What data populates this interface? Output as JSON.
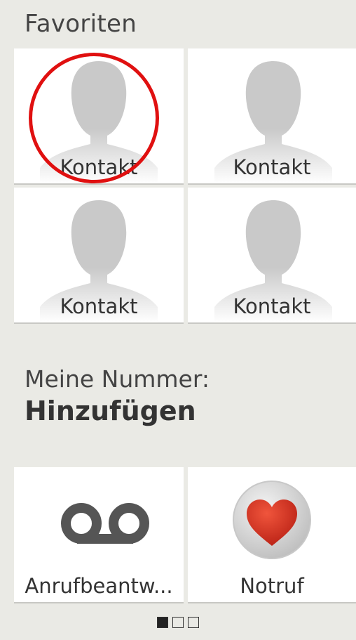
{
  "header": {
    "title": "Favoriten"
  },
  "favorites": [
    {
      "label": "Kontakt"
    },
    {
      "label": "Kontakt"
    },
    {
      "label": "Kontakt"
    },
    {
      "label": "Kontakt"
    }
  ],
  "my_number": {
    "label": "Meine Nummer:",
    "value": "Hinzufügen"
  },
  "shortcuts": [
    {
      "label": "Anrufbeantw...",
      "icon": "voicemail-icon"
    },
    {
      "label": "Notruf",
      "icon": "heart-icon"
    }
  ],
  "pager": {
    "pages": 3,
    "active": 1
  },
  "colors": {
    "highlight": "#e01010",
    "heart": "#d42a1c",
    "background": "#eaeae5"
  }
}
